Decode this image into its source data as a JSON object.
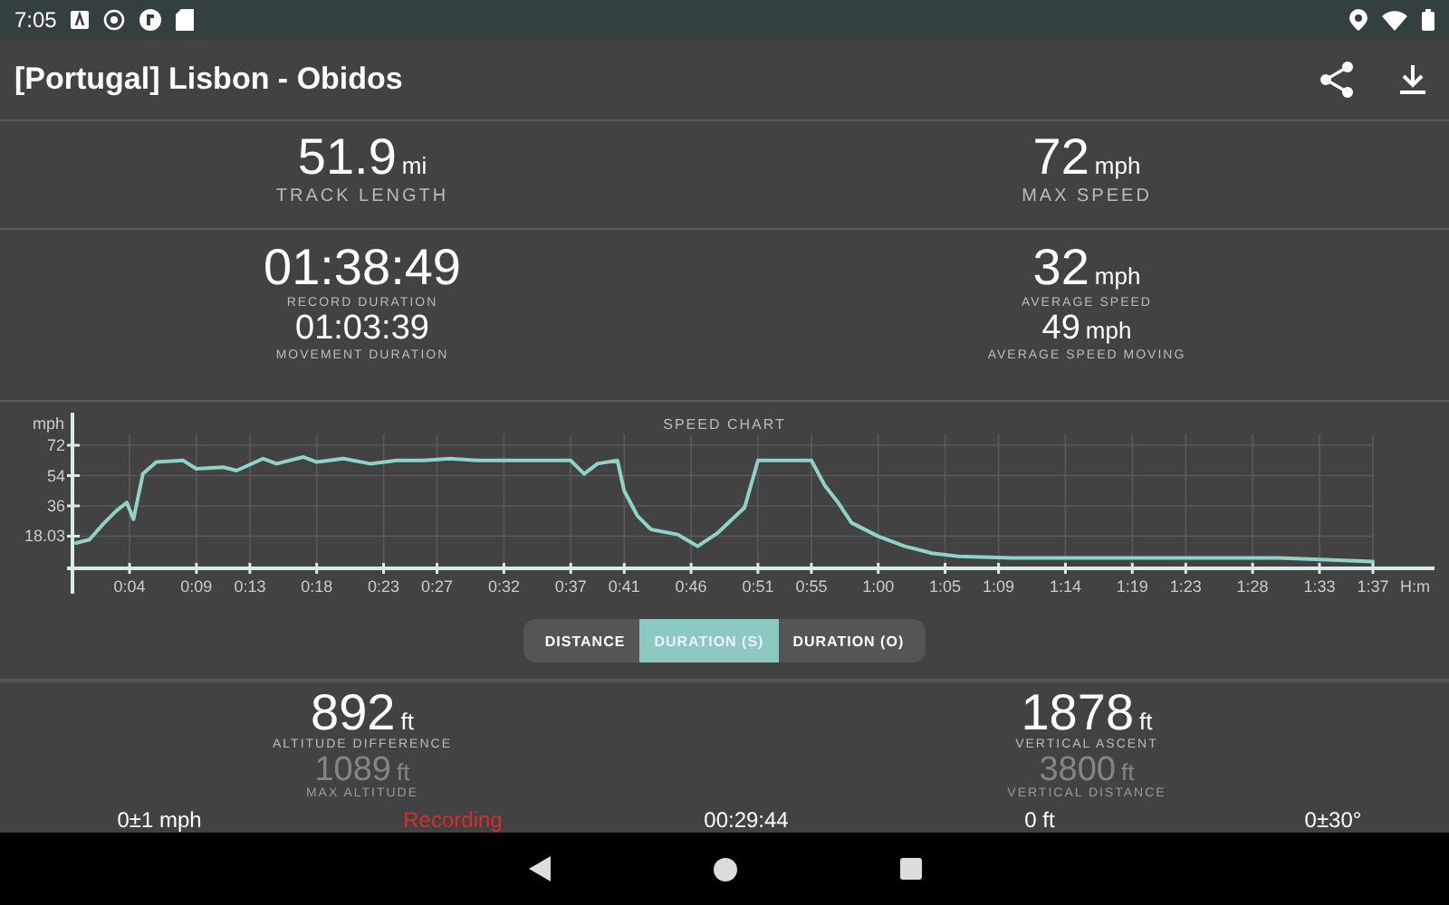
{
  "status_bar": {
    "time": "7:05"
  },
  "app_bar": {
    "title": "[Portugal] Lisbon - Obidos"
  },
  "stats_top": [
    {
      "value": "51.9",
      "unit": "mi",
      "label": "TRACK LENGTH"
    },
    {
      "value": "72",
      "unit": "mph",
      "label": "MAX SPEED"
    }
  ],
  "stats_mid": [
    {
      "value": "01:38:49",
      "label": "RECORD DURATION",
      "sub_value": "01:03:39",
      "sub_label": "MOVEMENT DURATION"
    },
    {
      "value": "32",
      "unit": "mph",
      "label": "AVERAGE SPEED",
      "sub_value": "49",
      "sub_unit": "mph",
      "sub_label": "AVERAGE SPEED MOVING"
    }
  ],
  "chart": {
    "chart_data": {
      "type": "line",
      "title": "SPEED CHART",
      "xlabel": "H:m",
      "ylabel": "mph",
      "ylim": [
        0,
        72
      ],
      "xlim": [
        0,
        97
      ],
      "grid": true,
      "yticks": [
        18.03,
        36,
        54,
        72
      ],
      "xticks": [
        {
          "value": 4,
          "label": "0:04"
        },
        {
          "value": 9,
          "label": "0:09"
        },
        {
          "value": 13,
          "label": "0:13"
        },
        {
          "value": 18,
          "label": "0:18"
        },
        {
          "value": 23,
          "label": "0:23"
        },
        {
          "value": 27,
          "label": "0:27"
        },
        {
          "value": 32,
          "label": "0:32"
        },
        {
          "value": 37,
          "label": "0:37"
        },
        {
          "value": 41,
          "label": "0:41"
        },
        {
          "value": 46,
          "label": "0:46"
        },
        {
          "value": 51,
          "label": "0:51"
        },
        {
          "value": 55,
          "label": "0:55"
        },
        {
          "value": 60,
          "label": "1:00"
        },
        {
          "value": 65,
          "label": "1:05"
        },
        {
          "value": 69,
          "label": "1:09"
        },
        {
          "value": 74,
          "label": "1:14"
        },
        {
          "value": 79,
          "label": "1:19"
        },
        {
          "value": 83,
          "label": "1:23"
        },
        {
          "value": 88,
          "label": "1:28"
        },
        {
          "value": 93,
          "label": "1:33"
        },
        {
          "value": 97,
          "label": "1:37"
        }
      ],
      "x": [
        0,
        1,
        2,
        3,
        3.8,
        4.3,
        5,
        6,
        8,
        9,
        11,
        12,
        14,
        15,
        17,
        18,
        20,
        22,
        24,
        26,
        28,
        30,
        32,
        34,
        36,
        37,
        38,
        39,
        40.5,
        41,
        42,
        43,
        45,
        46.5,
        48,
        50,
        51,
        53,
        55,
        56,
        57,
        58,
        60,
        62,
        64,
        66,
        70,
        80,
        90,
        97
      ],
      "series": [
        {
          "color": "#8fd3c8",
          "values": [
            14,
            16,
            25,
            33,
            38,
            28,
            55,
            62,
            63,
            58,
            59,
            57,
            64,
            61,
            65,
            62,
            64,
            61,
            63,
            63,
            64,
            63,
            63,
            63,
            63,
            63,
            55,
            61,
            63,
            45,
            30,
            22,
            19,
            12,
            20,
            35,
            63,
            63,
            63,
            48,
            38,
            26,
            18,
            12,
            8,
            6,
            5,
            5,
            5,
            3
          ]
        }
      ]
    }
  },
  "chart_modes": [
    {
      "label": "DISTANCE",
      "selected": false
    },
    {
      "label": "DURATION (S)",
      "selected": true
    },
    {
      "label": "DURATION (O)",
      "selected": false
    }
  ],
  "stats_bottom": [
    {
      "value": "892",
      "unit": "ft",
      "label": "ALTITUDE DIFFERENCE",
      "sub_value": "1089",
      "sub_unit": "ft",
      "sub_label": "MAX ALTITUDE"
    },
    {
      "value": "1878",
      "unit": "ft",
      "label": "VERTICAL ASCENT",
      "sub_value": "3800",
      "sub_unit": "ft",
      "sub_label": "VERTICAL DISTANCE"
    }
  ],
  "recording_overlay": [
    {
      "kind": "reading",
      "text": "0±1 mph"
    },
    {
      "kind": "status",
      "text": "Recording"
    },
    {
      "kind": "reading",
      "text": "00:29:44"
    },
    {
      "kind": "reading",
      "text": "0 ft"
    },
    {
      "kind": "reading",
      "text": "0±30°"
    }
  ]
}
